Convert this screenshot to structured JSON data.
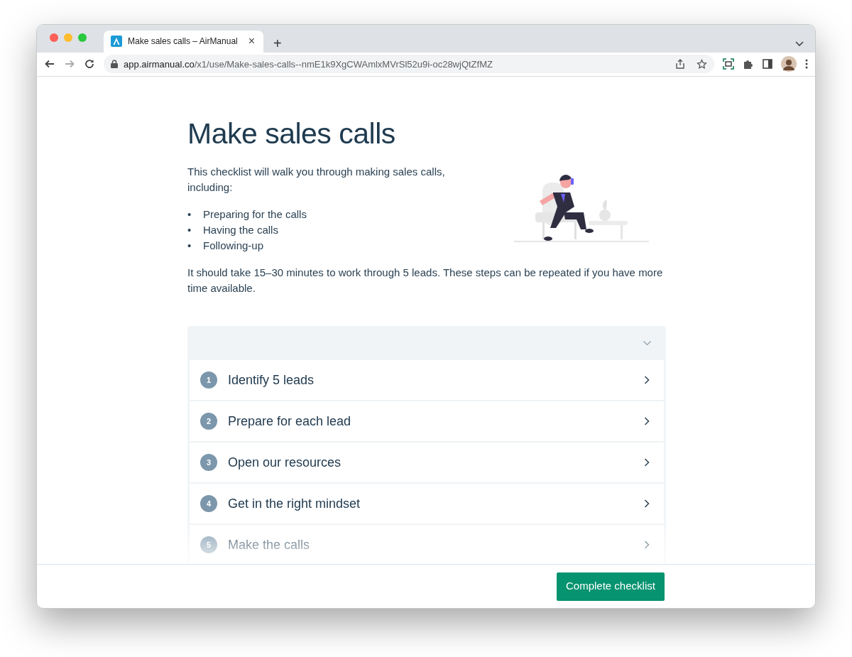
{
  "browser": {
    "tab": {
      "title": "Make sales calls – AirManual",
      "close": "×"
    },
    "new_tab": "+",
    "url": {
      "host": "app.airmanual.co",
      "path": "/x1/use/Make-sales-calls--nmE1k9XgCWAmlxMVrSl52u9i-oc28wjQtZfMZ"
    }
  },
  "checklist": {
    "title": "Make sales calls",
    "intro": "This checklist will walk you through making sales calls, including:",
    "bullets": [
      {
        "marker": "•",
        "text": "Preparing for the calls"
      },
      {
        "marker": "•",
        "text": "Having the calls"
      },
      {
        "marker": "•",
        "text": "Following-up"
      }
    ],
    "note": "It should take 15–30 minutes to work through 5 leads. These steps can be repeated if you have more time available.",
    "steps": [
      {
        "number": "1",
        "title": "Identify 5 leads"
      },
      {
        "number": "2",
        "title": "Prepare for each lead"
      },
      {
        "number": "3",
        "title": "Open our resources"
      },
      {
        "number": "4",
        "title": "Get in the right mindset"
      },
      {
        "number": "5",
        "title": "Make the calls"
      }
    ]
  },
  "footer": {
    "button": "Complete checklist"
  }
}
